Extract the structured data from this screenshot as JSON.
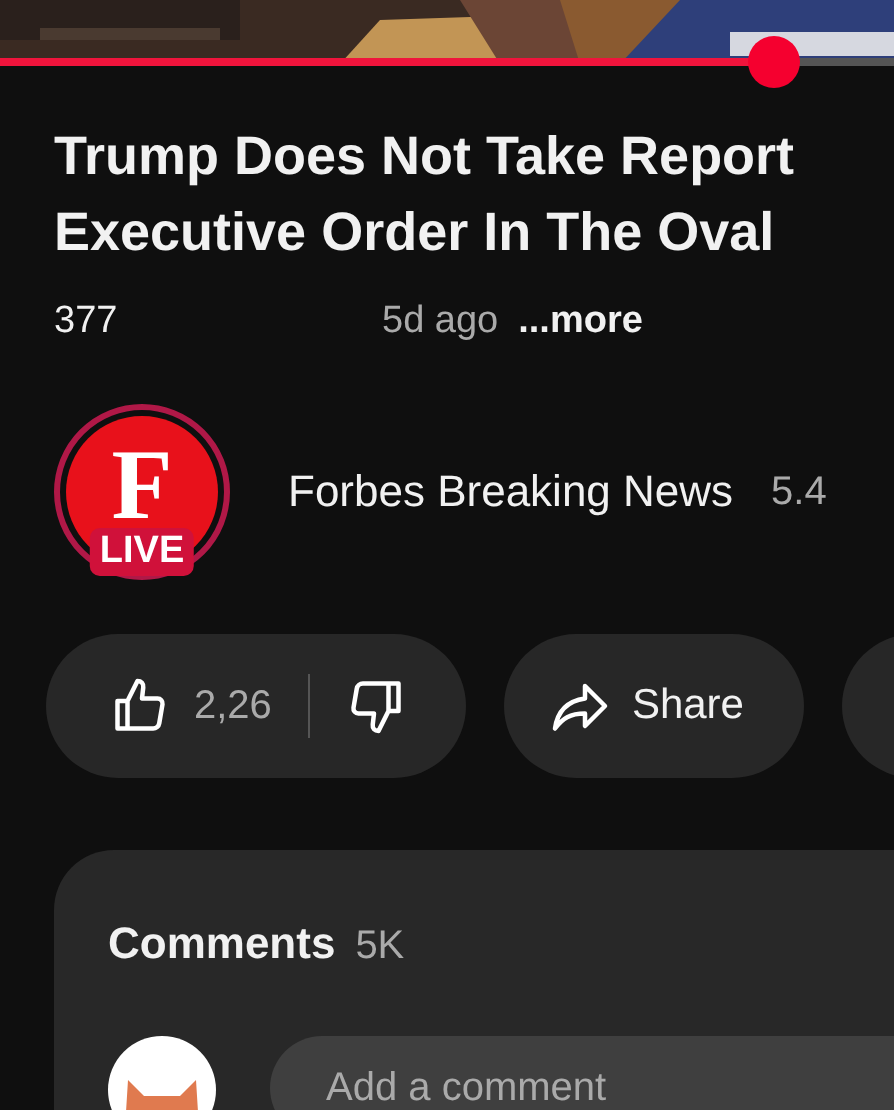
{
  "player": {
    "progress": {
      "level": 0.865
    }
  },
  "video": {
    "title_lines": [
      "Trump Does Not Take Report",
      "Executive Order In The Oval"
    ],
    "views": "377",
    "age": "5d ago",
    "more": "...more"
  },
  "channel": {
    "avatar_letter": "F",
    "avatar_badge": "LIVE",
    "name": "Forbes Breaking News",
    "subscribers": "5.4"
  },
  "actions": {
    "likes": "2,26",
    "share": "Share"
  },
  "comments": {
    "title": "Comments",
    "count": "5K",
    "input": {
      "placeholder": "Add a comment"
    }
  }
}
